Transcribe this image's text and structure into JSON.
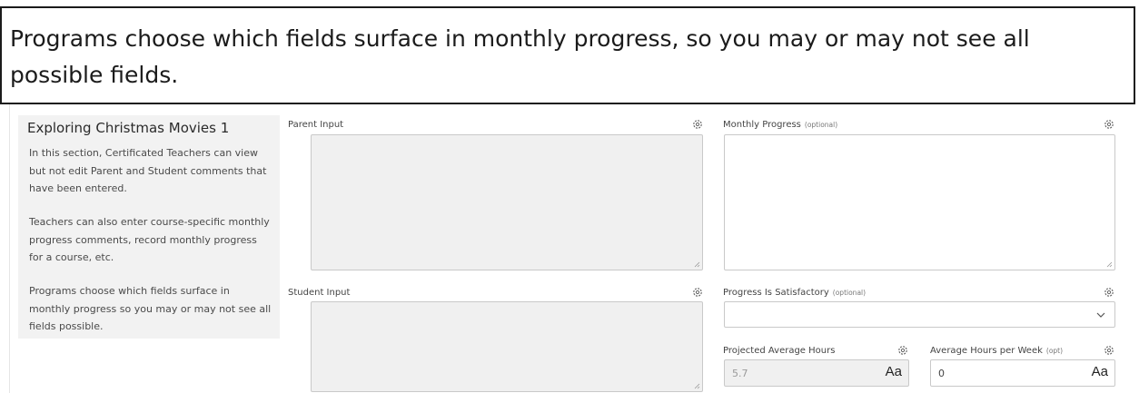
{
  "callout": {
    "text": "Programs choose which fields surface in monthly progress, so you may or may not see all possible fields."
  },
  "sidebar": {
    "title": "Exploring Christmas Movies 1",
    "paragraphs": [
      "In this section, Certificated Teachers can view but not edit Parent and Student comments that have been entered.",
      "Teachers can also enter course-specific monthly progress comments, record monthly progress for a course, etc.",
      "Programs choose which fields surface in monthly progress so you may or may not see all fields possible."
    ]
  },
  "fields": {
    "parent_input": {
      "label": "Parent Input",
      "value": ""
    },
    "student_input": {
      "label": "Student Input",
      "value": ""
    },
    "monthly_progress": {
      "label": "Monthly Progress",
      "optional": "(optional)",
      "value": ""
    },
    "progress_satisfactory": {
      "label": "Progress Is Satisfactory",
      "optional": "(optional)",
      "value": ""
    },
    "projected_hours": {
      "label": "Projected Average Hours",
      "value": "5.7",
      "format_glyph": "Aa"
    },
    "avg_hours_week": {
      "label": "Average Hours per Week",
      "optional": "(opt)",
      "value": "0",
      "format_glyph": "Aa"
    }
  },
  "icons": {
    "settings": "gear-icon",
    "resize": "resize-grip-icon",
    "dropdown": "chevron-down-icon",
    "format": "text-format-icon"
  },
  "colors": {
    "readonly_bg": "#f0f0f0",
    "sidebar_bg": "#f2f2f2",
    "border": "#c9c9c9",
    "callout_border": "#1b1b1b"
  }
}
